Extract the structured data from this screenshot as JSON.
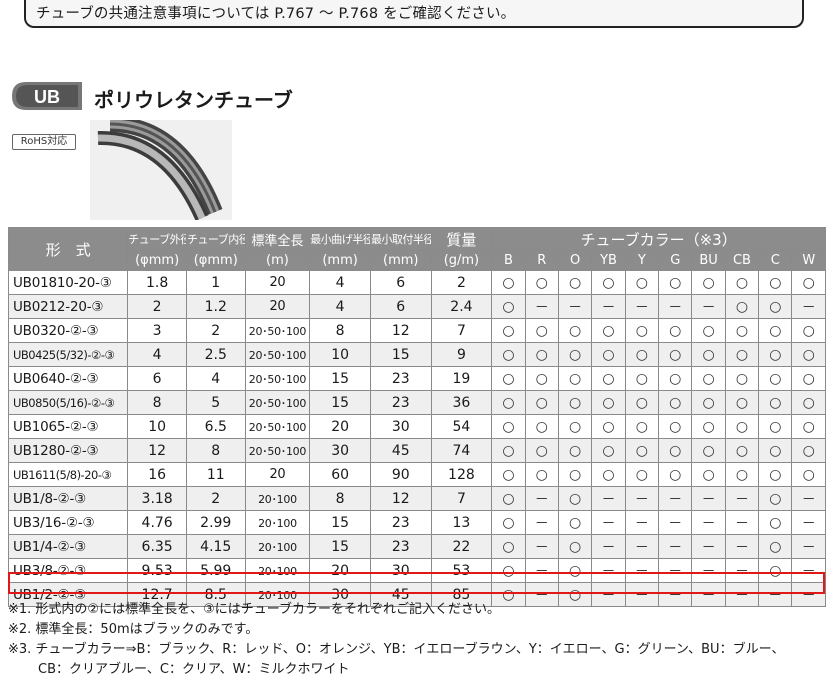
{
  "notice": "チューブの共通注意事項については P.767 ～ P.768 をご確認ください。",
  "logo_text": "UB",
  "title": "ポリウレタンチューブ",
  "rohs": "RoHS対応",
  "headers": {
    "model": "形　式",
    "od": "チューブ外径",
    "od_unit": "(φmm)",
    "id": "チューブ内径",
    "id_unit": "(φmm)",
    "length": "標準全長",
    "length_unit": "(m)",
    "bend": "最小曲げ半径",
    "bend_unit": "(mm)",
    "mount": "最小取付半径",
    "mount_unit": "(mm)",
    "mass": "質量",
    "mass_unit": "(g/m)",
    "colors_title": "チューブカラー（※3）",
    "colors": [
      "B",
      "R",
      "O",
      "YB",
      "Y",
      "G",
      "BU",
      "CB",
      "C",
      "W"
    ]
  },
  "rows": [
    {
      "model": "UB01810-20-③",
      "od": "1.8",
      "id": "1",
      "len": "20",
      "bend": "4",
      "mount": "6",
      "mass": "2",
      "c": [
        "○",
        "○",
        "○",
        "○",
        "○",
        "○",
        "○",
        "○",
        "○",
        "○"
      ]
    },
    {
      "model": "UB0212-20-③",
      "od": "2",
      "id": "1.2",
      "len": "20",
      "bend": "4",
      "mount": "6",
      "mass": "2.4",
      "c": [
        "○",
        "－",
        "－",
        "－",
        "－",
        "－",
        "－",
        "○",
        "○",
        "－"
      ]
    },
    {
      "model": "UB0320-②-③",
      "od": "3",
      "id": "2",
      "len": "20･50･100",
      "bend": "8",
      "mount": "12",
      "mass": "7",
      "c": [
        "○",
        "○",
        "○",
        "○",
        "○",
        "○",
        "○",
        "○",
        "○",
        "○"
      ]
    },
    {
      "model": "UB0425(5/32)-②-③",
      "od": "4",
      "id": "2.5",
      "len": "20･50･100",
      "bend": "10",
      "mount": "15",
      "mass": "9",
      "c": [
        "○",
        "○",
        "○",
        "○",
        "○",
        "○",
        "○",
        "○",
        "○",
        "○"
      ]
    },
    {
      "model": "UB0640-②-③",
      "od": "6",
      "id": "4",
      "len": "20･50･100",
      "bend": "15",
      "mount": "23",
      "mass": "19",
      "c": [
        "○",
        "○",
        "○",
        "○",
        "○",
        "○",
        "○",
        "○",
        "○",
        "○"
      ]
    },
    {
      "model": "UB0850(5/16)-②-③",
      "od": "8",
      "id": "5",
      "len": "20･50･100",
      "bend": "15",
      "mount": "23",
      "mass": "36",
      "c": [
        "○",
        "○",
        "○",
        "○",
        "○",
        "○",
        "○",
        "○",
        "○",
        "○"
      ]
    },
    {
      "model": "UB1065-②-③",
      "od": "10",
      "id": "6.5",
      "len": "20･50･100",
      "bend": "20",
      "mount": "30",
      "mass": "54",
      "c": [
        "○",
        "○",
        "○",
        "○",
        "○",
        "○",
        "○",
        "○",
        "○",
        "○"
      ]
    },
    {
      "model": "UB1280-②-③",
      "od": "12",
      "id": "8",
      "len": "20･50･100",
      "bend": "30",
      "mount": "45",
      "mass": "74",
      "c": [
        "○",
        "○",
        "○",
        "○",
        "○",
        "○",
        "○",
        "○",
        "○",
        "○"
      ]
    },
    {
      "model": "UB1611(5/8)-20-③",
      "od": "16",
      "id": "11",
      "len": "20",
      "bend": "60",
      "mount": "90",
      "mass": "128",
      "c": [
        "○",
        "○",
        "○",
        "○",
        "○",
        "○",
        "○",
        "○",
        "○",
        "○"
      ]
    },
    {
      "model": "UB1/8-②-③",
      "od": "3.18",
      "id": "2",
      "len": "20･100",
      "bend": "8",
      "mount": "12",
      "mass": "7",
      "c": [
        "○",
        "－",
        "○",
        "－",
        "－",
        "－",
        "－",
        "－",
        "○",
        "－"
      ]
    },
    {
      "model": "UB3/16-②-③",
      "od": "4.76",
      "id": "2.99",
      "len": "20･100",
      "bend": "15",
      "mount": "23",
      "mass": "13",
      "c": [
        "○",
        "－",
        "○",
        "－",
        "－",
        "－",
        "－",
        "－",
        "○",
        "－"
      ]
    },
    {
      "model": "UB1/4-②-③",
      "od": "6.35",
      "id": "4.15",
      "len": "20･100",
      "bend": "15",
      "mount": "23",
      "mass": "22",
      "c": [
        "○",
        "－",
        "○",
        "－",
        "－",
        "－",
        "－",
        "－",
        "○",
        "－"
      ]
    },
    {
      "model": "UB3/8-②-③",
      "od": "9.53",
      "id": "5.99",
      "len": "20･100",
      "bend": "20",
      "mount": "30",
      "mass": "53",
      "c": [
        "○",
        "－",
        "○",
        "－",
        "－",
        "－",
        "－",
        "－",
        "○",
        "－"
      ]
    },
    {
      "model": "UB1/2-②-③",
      "od": "12.7",
      "id": "8.5",
      "len": "20･100",
      "bend": "30",
      "mount": "45",
      "mass": "85",
      "c": [
        "○",
        "－",
        "○",
        "－",
        "－",
        "－",
        "－",
        "－",
        "－",
        "－"
      ]
    }
  ],
  "notes": [
    "※1. 形式内の②には標準全長を、③にはチューブカラーをそれぞれご記入ください。",
    "※2. 標準全長：50mはブラックのみです。",
    "※3. チューブカラー⇒B：ブラック、R：レッド、O：オレンジ、YB：イエローブラウン、Y：イエロー、G：グリーン、BU：ブルー、",
    "CB：クリアブルー、C：クリア、W：ミルクホワイト"
  ]
}
